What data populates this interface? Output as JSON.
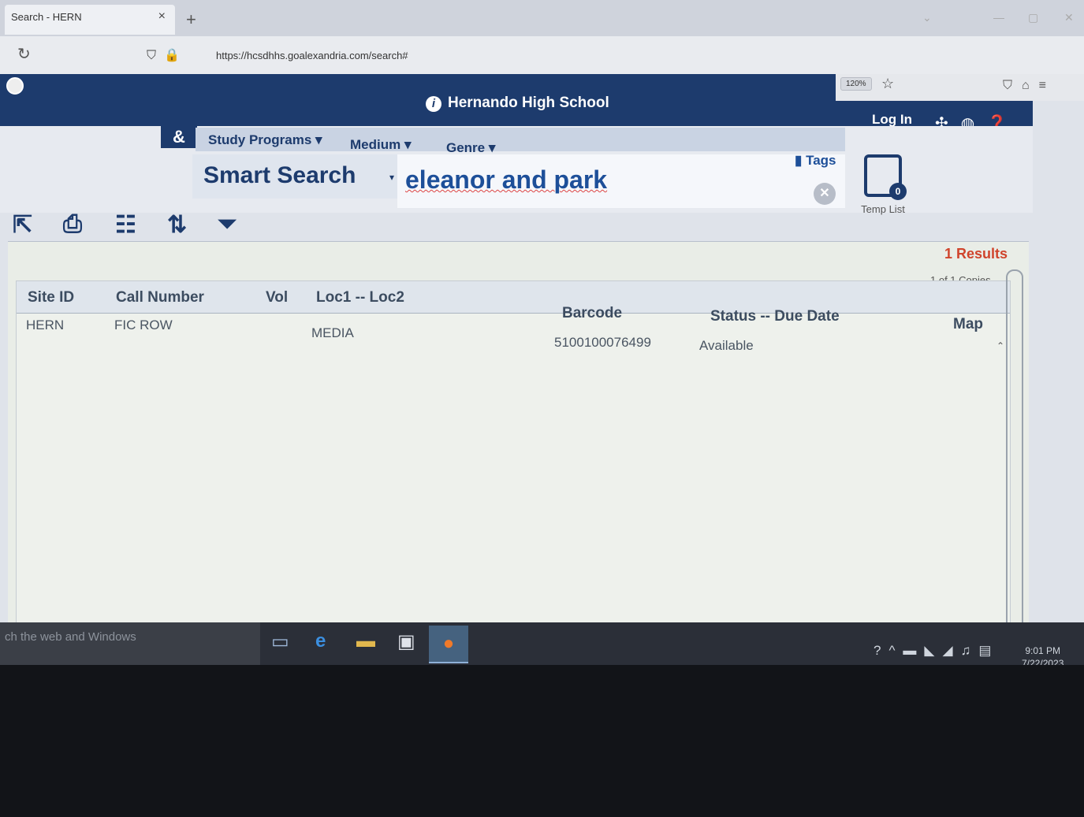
{
  "browser": {
    "tab_title": "Search - HERN",
    "tab_close": "×",
    "new_tab": "+",
    "url": "https://hcsdhhs.goalexandria.com/search#",
    "zoom": "120%"
  },
  "header": {
    "school_name": "Hernando High School",
    "login_label": "Log In"
  },
  "nav": {
    "logo": "&",
    "menus": [
      "Study Programs ▾",
      "Medium ▾",
      "Genre ▾"
    ]
  },
  "search": {
    "scope_label": "Smart Search",
    "query": "eleanor and park",
    "tags_label": "Tags"
  },
  "temp_list": {
    "count": "0",
    "label": "Temp List"
  },
  "results": {
    "count_label": "1 Results",
    "copies_label": "1 of 1 Copies",
    "columns": [
      "Site ID",
      "Call Number",
      "Vol",
      "Loc1 -- Loc2",
      "Barcode",
      "Status -- Due Date",
      "Map"
    ],
    "rows": [
      {
        "site_id": "HERN",
        "call_number": "FIC ROW",
        "vol": "",
        "loc": "MEDIA",
        "barcode": "5100100076499",
        "status": "Available",
        "map": ""
      }
    ]
  },
  "taskbar": {
    "search_placeholder": "ch the web and Windows",
    "time": "9:01 PM",
    "date": "7/22/2023"
  }
}
